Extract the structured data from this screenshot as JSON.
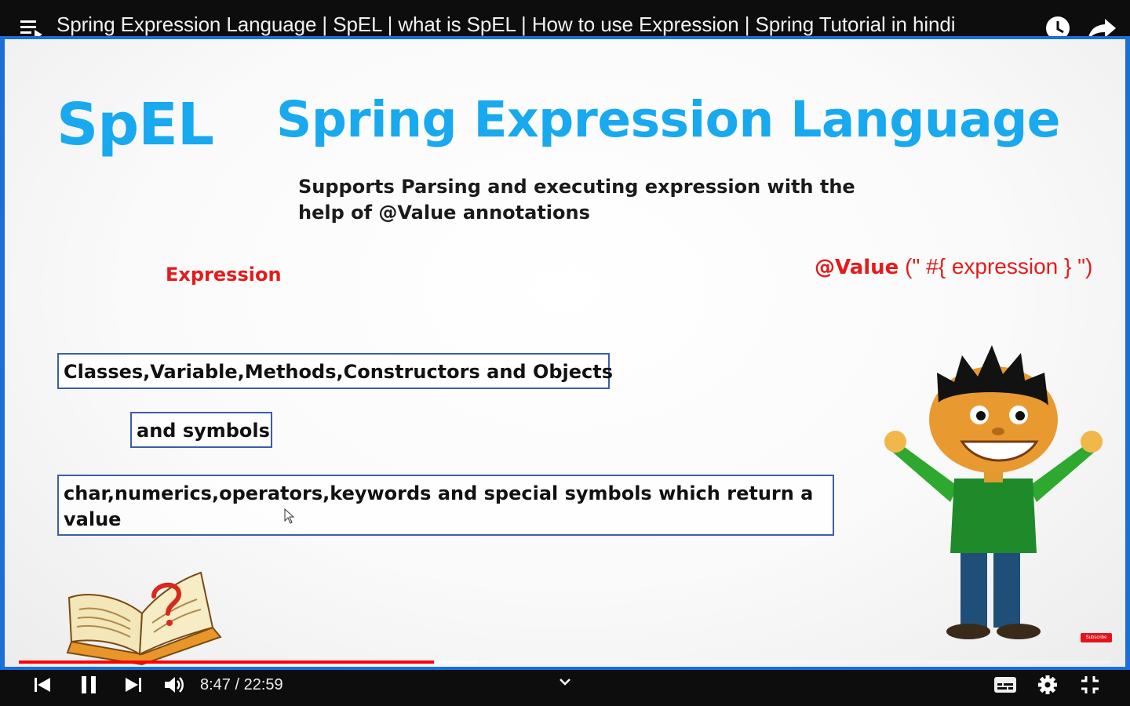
{
  "player": {
    "title": "Spring Expression Language | SpEL | what is SpEL | How to use Expression | Spring Tutorial in hindi",
    "current_time": "8:47",
    "time_separator": "/",
    "duration": "22:59",
    "progress_played_fraction": 0.38,
    "progress_buffered_fraction": 0.42,
    "accent_color": "#ff0000"
  },
  "icons": {
    "top_left": "playlist-queue-icon",
    "top_right": [
      "watch-later-clock-icon",
      "share-arrow-icon"
    ],
    "controls": [
      "previous-icon",
      "pause-icon",
      "next-icon",
      "volume-icon",
      "chevron-down-icon",
      "captions-icon",
      "settings-gear-icon",
      "exit-fullscreen-icon"
    ]
  },
  "slide": {
    "logo": "SpEL",
    "heading": "Spring Expression Language",
    "subtitle_line1": "Supports Parsing and executing expression with the",
    "subtitle_line2": "help of @Value annotations",
    "expression_label": "Expression",
    "annotation_keyword": "@Value",
    "annotation_args": " (\" #{ expression } \")",
    "box1": "Classes,Variable,Methods,Constructors and Objects",
    "box2": "and symbols",
    "box3": "char,numerics,operators,keywords and special symbols which return a value",
    "heading_color": "#18a9ee",
    "label_color": "#e51b1b",
    "subscribe_badge": "Subscribe"
  }
}
